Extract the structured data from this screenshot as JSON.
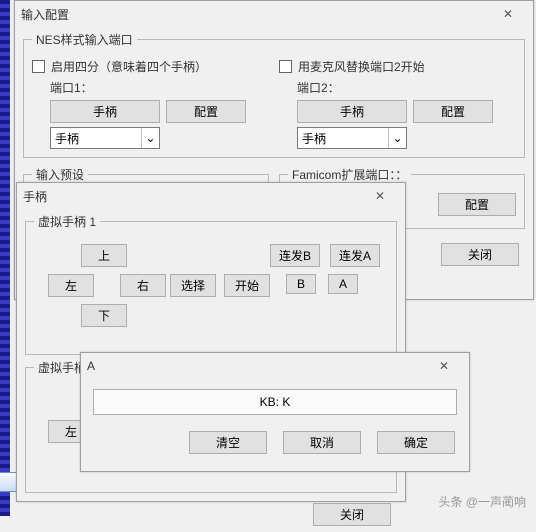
{
  "main": {
    "title": "输入配置",
    "group1": {
      "legend": "NES样式输入端口",
      "enable_quad": "启用四分（意味着四个手柄）",
      "mic_replace": "用麦克风替换端口2开始",
      "port1": "端口1：",
      "port2": "端口2：",
      "gamepad": "手柄",
      "configure": "配置",
      "select_val": "手柄"
    },
    "presets": {
      "legend": "输入预设"
    },
    "famicom": {
      "legend": "Famicom扩展端口：：",
      "configure": "配置"
    },
    "close": "关闭"
  },
  "pad": {
    "title": "手柄",
    "header": "虚拟手柄 1",
    "header2": "虚拟手柄",
    "up": "上",
    "down": "下",
    "left": "左",
    "right": "右",
    "select": "选择",
    "start": "开始",
    "b": "B",
    "a": "A",
    "turboB": "连发B",
    "turboA": "连发A",
    "close": "关闭"
  },
  "keydlg": {
    "title": "A",
    "value": "KB: K",
    "clear": "清空",
    "cancel": "取消",
    "ok": "确定"
  },
  "watermark": "头条 @一声蔺响",
  "glyph": {
    "x": "✕",
    "down": "⌄"
  }
}
